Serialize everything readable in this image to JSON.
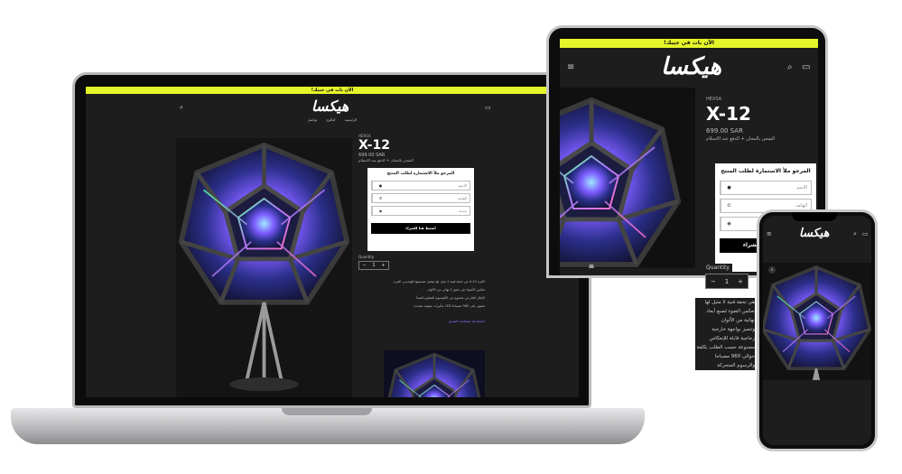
{
  "announcement": "الآن بات في جيبك!",
  "logo_text": "هيكسا",
  "vendor": "HEXSA",
  "product_title": "X-12",
  "price": "699.00 SAR",
  "shipping_note": "الشحن بالمجان + الدفع عند الاستلام",
  "form": {
    "heading": "المرجو ملأ الاستمارة لطلب المنتج",
    "name_placeholder": "الاسم",
    "phone_placeholder": "الهاتف",
    "city_placeholder": "مدينة",
    "buy_label": "اضغط هنا للشراء",
    "buy_label_tablet": "اضغط هنا للشراء"
  },
  "quantity": {
    "label": "Quantity",
    "value": "1",
    "minus": "−",
    "plus": "+"
  },
  "nav": [
    "الرئيسية",
    "كتالوج",
    "تواصل"
  ],
  "description": [
    "الكرة X-12 هي تحفة فنية لا مثيل لها بفضل تصميمها الهندسي الفريد",
    "تعكس الأضواء في عمق لا نهائي من الألوان",
    "الإطار الخارجي مصنوع من الألومنيوم المقاوم للصدأ",
    "تحتوي على 960 مصباحا LED بتأثيرات ضوئية متعددة",
    "اضغط هنا لمشاهدة الفيديو"
  ],
  "phone_description": [
    "هي تحفة فنية لا مثيل لها",
    "تعكس الضوء لصنع أبعاد",
    "نهائية من الألوان",
    "وتتميز بواجهة خارجية",
    "زجاجية قابلة للإنعكاس",
    "مصنوعة حسب الطلب بكلفة",
    "حوالي 960 مصباحا",
    "والرسوم المتحركة"
  ],
  "icons": {
    "menu": "menu-icon",
    "search": "search-icon",
    "cart": "cart-icon",
    "user": "user-icon",
    "phone": "phone-icon",
    "location": "location-icon",
    "zoom": "zoom-icon"
  },
  "colors": {
    "accent": "#e4f52a",
    "background": "#1d1d1d",
    "button": "#000000",
    "link": "#8c6cff"
  }
}
